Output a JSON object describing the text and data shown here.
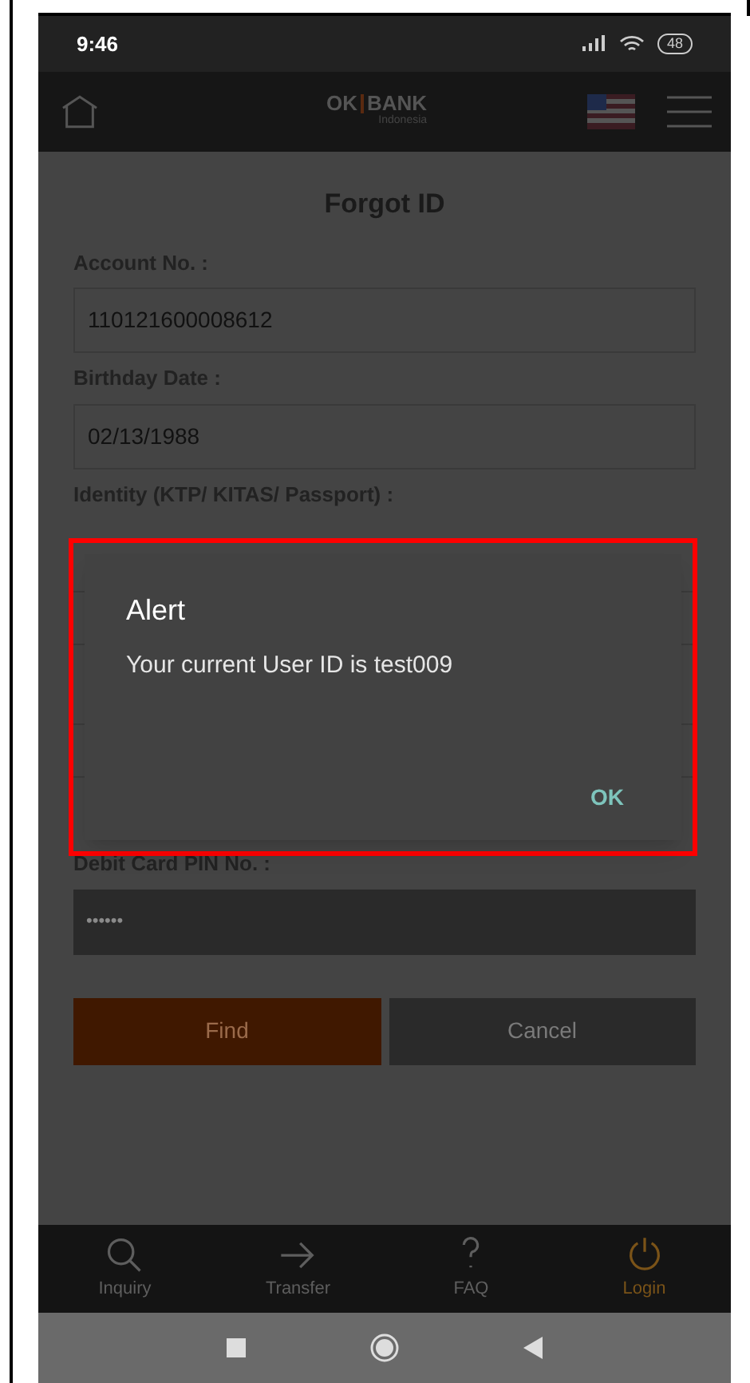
{
  "status_bar": {
    "time": "9:46",
    "battery": "48"
  },
  "header": {
    "logo_left": "OK",
    "logo_right": "BANK",
    "logo_sub": "Indonesia"
  },
  "title": "Forgot ID",
  "fields": [
    {
      "label": "Account No. :",
      "value": "110121600008612"
    },
    {
      "label": "Birthday Date :",
      "value": "02/13/1988"
    }
  ],
  "identity_label": "Identity (KTP/ KITAS/ Passport) :",
  "pin": {
    "label": "Debit Card PIN No. :",
    "value": "••••••"
  },
  "buttons": [
    {
      "kind": "primary",
      "label": "Find"
    },
    {
      "kind": "secondary",
      "label": "Cancel"
    }
  ],
  "dialog": {
    "title": "Alert",
    "message": "Your current User ID is test009",
    "button": "OK"
  },
  "bottom_nav": [
    {
      "kind": "search",
      "label": "Inquiry",
      "selected": false
    },
    {
      "kind": "arrow",
      "label": "Transfer",
      "selected": false
    },
    {
      "kind": "question",
      "label": "FAQ",
      "selected": false
    },
    {
      "kind": "power",
      "label": "Login",
      "selected": true
    }
  ]
}
